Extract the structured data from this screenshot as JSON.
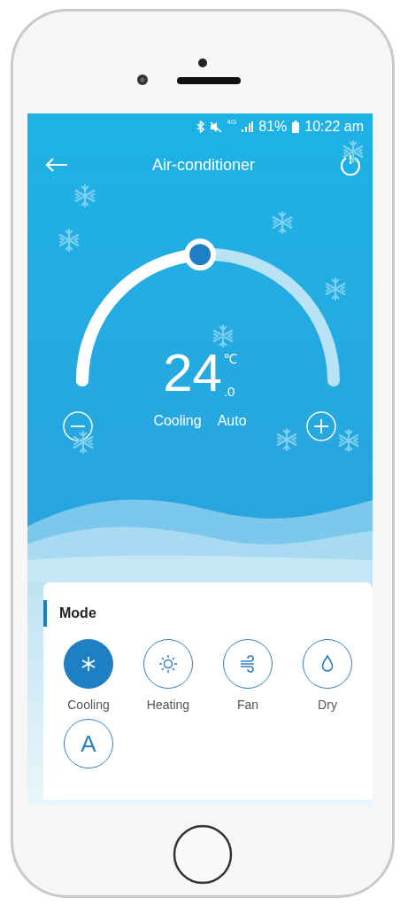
{
  "status_bar": {
    "network": "4G",
    "battery": "81%",
    "time": "10:22 am"
  },
  "app_bar": {
    "title": "Air-conditioner"
  },
  "thermostat": {
    "temperature": "24",
    "unit": "℃",
    "decimal": ".0",
    "level": 0.48,
    "mode": "Cooling",
    "fan": "Auto"
  },
  "mode_panel": {
    "title": "Mode",
    "modes": [
      {
        "kind": "cooling",
        "label": "Cooling",
        "selected": true
      },
      {
        "kind": "heating",
        "label": "Heating",
        "selected": false
      },
      {
        "kind": "fan",
        "label": "Fan",
        "selected": false
      },
      {
        "kind": "dry",
        "label": "Dry",
        "selected": false
      },
      {
        "kind": "auto",
        "glyph": "A",
        "selected": false
      }
    ]
  }
}
